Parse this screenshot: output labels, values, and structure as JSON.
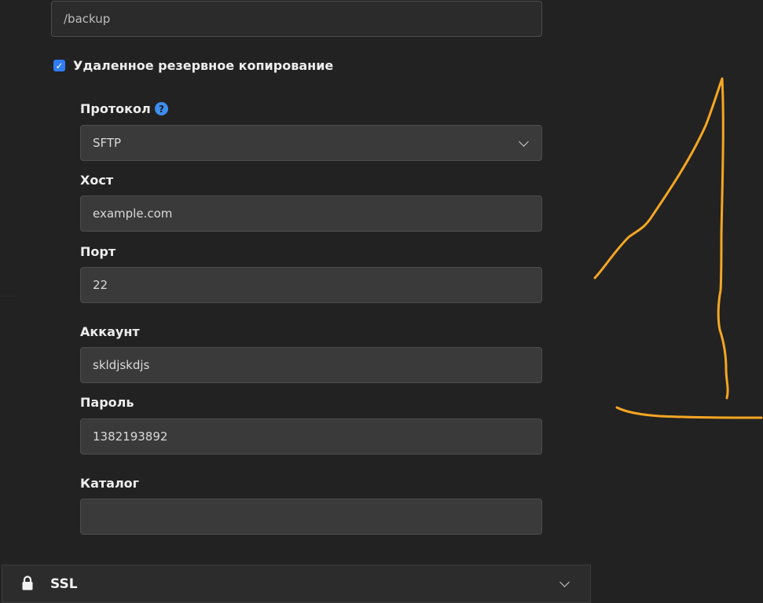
{
  "backup_path": {
    "value": "/backup"
  },
  "remote_backup": {
    "checked": true,
    "label": "Удаленное резервное копирование"
  },
  "protocol": {
    "label": "Протокол",
    "help_icon": "question-circle-icon",
    "value": "SFTP"
  },
  "host": {
    "label": "Хост",
    "value": "example.com"
  },
  "port": {
    "label": "Порт",
    "value": "22"
  },
  "account": {
    "label": "Аккаунт",
    "value": "skldjskdjs"
  },
  "password": {
    "label": "Пароль",
    "value": "1382193892"
  },
  "directory": {
    "label": "Каталог",
    "value": ""
  },
  "ssl_section": {
    "label": "SSL",
    "icon": "lock-icon",
    "expanded": false
  },
  "colors": {
    "background": "#222222",
    "input_bg": "#3a3a3a",
    "accent": "#2f7cf6",
    "annotation": "#f5a623"
  }
}
